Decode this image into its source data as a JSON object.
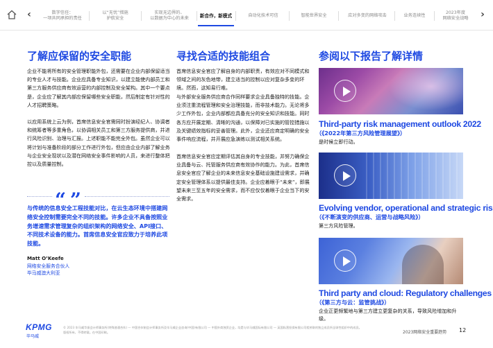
{
  "nav": {
    "tabs": [
      {
        "label": "数字信任：\n一项共同承担的责任",
        "active": false
      },
      {
        "label": "以“无忧”措施\n护航安全",
        "active": false
      },
      {
        "label": "实现无边界的、\n以数据为中心的未来",
        "active": false
      },
      {
        "label": "新合作，新模式",
        "active": true
      },
      {
        "label": "自动化技术可信",
        "active": false
      },
      {
        "label": "智能世界安全",
        "active": false
      },
      {
        "label": "应对多变的网络攻击",
        "active": false
      },
      {
        "label": "业务连续性",
        "active": false
      },
      {
        "label": "2023年度\n网络安全战略",
        "active": false
      }
    ]
  },
  "col1": {
    "heading": "了解应保留的安全职能",
    "para1": "企业不能将所有的安全管理职能外包，还需要在企业内部保留适当的专业人才与技能。企业应具备专业知识，以建立能使内部员工和第三方服务供应商有效运营的内部控制及安全架构。其中一个要点是，企业应了解其内部应保留哪些安全职能，然后制定有针对性的人才招聘策略。",
    "para2": "以应用系统上云为例，首席信息安全官需同时扮演经纪人、协调者和统筹者等多重角色，以协调相关员工和第三方服务提供商，并进行风险识别、治理与汇报。上述职能不能完全外包。虽然企业可以将计划与准备阶段的部分工作进行外包，但应由企业内部了解业务与企业安全现状以及潜在网络安全事件影响的人员，来进行整体把控以及质量控制。",
    "quote_mark": "“ ”",
    "quote": "与传统的信息安全工程技能对比，在云生态环境中搭建网络安全控制需要完全不同的技能。许多企业不具备按照业务增速需求管理复杂的组织架构的网络安全、API接口、不同技术设备的能力。首席信息安全官应致力于培养此项技能。",
    "author": "Matt O’Keefe",
    "author_role1": "网络安全服务合伙人",
    "author_role2": "毕马威澳大利亚"
  },
  "col2": {
    "heading": "寻找合适的技能组合",
    "para1": "首席信息安全官应了解自身的内部职责，有效应对不同模式和领域之间的灰色地带，建立适当的控制以应对复杂多变的环境。然而，这知易行难。",
    "para2": "与外部安全服务供应商合作同样要求企业具备独特的技能。企业须注重流程管理和安全治理技能，而非技术能力。无论将多少工作外包，企业内部都应具备充分的安全知识和技能。同时各方应开展定期、清晰的沟通，以保障对已实施的管控措施以及关键绩效指标的妥善管理。此外，企业还应商定明确的安全事件响应流程，并开展应急演练以测试相关系统。",
    "para3": "首席信息安全官应定期评估其自身的专业技能，并努力确保企业具备与云、托管服务供应商有效协作的能力。为此，首席信息安全官应了解企业的未来信息安全基础设施建设需求，并确定安全管理体系以提供最佳支持。企业应着眼于“未来”，即展望未来三至五年的安全需求，而不应仅仅着眼于企业当下的安全需求。"
  },
  "col3": {
    "heading": "参阅以下报告了解详情",
    "reports": [
      {
        "title": "Third-party risk management outlook 2022",
        "subtitle": "（《2022年第三方风险管理展望》）",
        "desc": "是时候立即行动。"
      },
      {
        "title": "Evolving vendor, operational and strategic risks",
        "subtitle": "（《不断演变的供应商、运营与战略风险》）",
        "desc": "第三方风险管理。"
      },
      {
        "title": "Third party and cloud: Regulatory challenges",
        "subtitle": "（《第三方与云：监管挑战》）",
        "desc": "企业正更频繁地与第三方建立更复杂的关系，导致风险增加和升级。"
      }
    ]
  },
  "footer": {
    "logo": "KPMG",
    "logo_sub": "毕马威",
    "fine_print": "© 2023 毕马威华振会计师事务所(特殊普通合伙) — 中国合伙制会计师事务所及毕马威企业咨询(中国)有限公司 — 中国外商独资企业，均是与毕马威国际有限公司 — 英国私营担保有限公司相关联的独立成员所全球性组织中的成员。版权所有，不得转载。在中国印刷。",
    "report_title": "2023网络安全重要趋势",
    "page": "12"
  },
  "icons": {
    "home": "home-icon",
    "prev": "chevron-left-icon",
    "next": "chevron-right-icon",
    "play": "play-icon"
  },
  "colors": {
    "accent": "#1e49e2",
    "text": "#1a1a1a",
    "muted": "#8a8a8a"
  }
}
